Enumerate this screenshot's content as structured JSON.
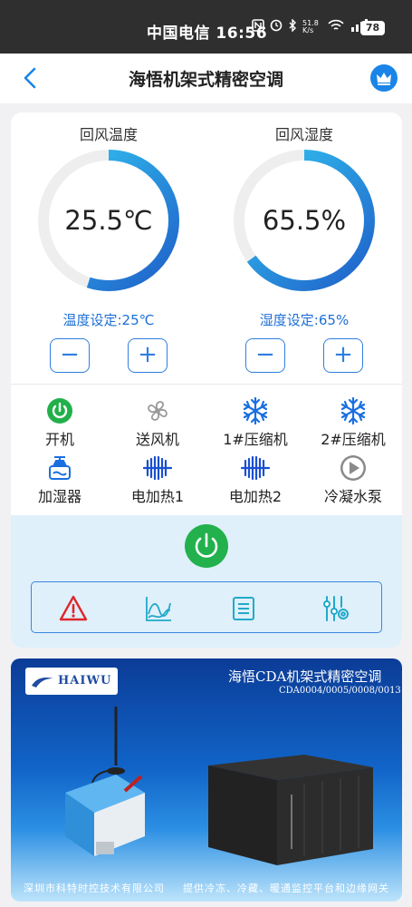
{
  "status_bar": {
    "carrier_time": "中国电信 16:56",
    "net_speed": "51.8 K/s",
    "battery": "78"
  },
  "header": {
    "title": "海悟机架式精密空调"
  },
  "return_air_temperature": {
    "label": "回风温度",
    "value": "25.5℃",
    "setpoint": "温度设定:25℃",
    "fill_fraction": 0.55,
    "minus": "−",
    "plus": "+"
  },
  "return_air_humidity": {
    "label": "回风湿度",
    "value": "65.5%",
    "setpoint": "湿度设定:65%",
    "fill_fraction": 0.65,
    "minus": "−",
    "plus": "+"
  },
  "devices": [
    {
      "label": "开机",
      "icon": "power-on-icon",
      "color": "#22b04b"
    },
    {
      "label": "送风机",
      "icon": "fan-icon",
      "color": "#9a9a9a"
    },
    {
      "label": "1#压缩机",
      "icon": "snowflake-icon",
      "color": "#1a6fe0"
    },
    {
      "label": "2#压缩机",
      "icon": "snowflake-icon",
      "color": "#1a6fe0"
    },
    {
      "label": "加湿器",
      "icon": "humidifier-icon",
      "color": "#1a6fe0"
    },
    {
      "label": "电加热1",
      "icon": "heater-icon",
      "color": "#1a4fd0"
    },
    {
      "label": "电加热2",
      "icon": "heater-icon",
      "color": "#1a4fd0"
    },
    {
      "label": "冷凝水泵",
      "icon": "pump-play-icon",
      "color": "#8a8a8a"
    }
  ],
  "toolbar": {
    "items": [
      "alarm-icon",
      "trend-chart-icon",
      "list-icon",
      "settings-sliders-icon"
    ]
  },
  "banner": {
    "brand": "HAIWU",
    "title": "海悟CDA机架式精密空调",
    "models": "CDA0004/0005/0008/0013",
    "company": "深圳市科特时控技术有限公司",
    "slogan": "提供冷冻、冷藏、暖通监控平台和边缘网关"
  },
  "colors": {
    "accent": "#1a84e8",
    "gauge_start": "#1f5fc9",
    "gauge_end": "#33c8f2",
    "power_green": "#23b14d"
  }
}
